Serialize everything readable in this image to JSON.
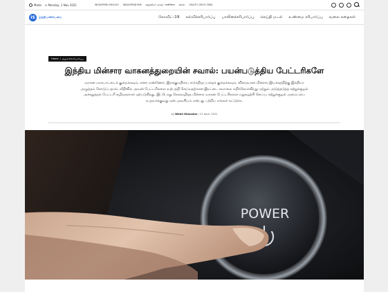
{
  "topbar": {
    "mode_label": "Mode",
    "date": "Monday, 1 Nov 2021",
    "links": [
      "INDIASPEND ENGLISH",
      "INDIASPEND हिन्दी",
      "ബ്രേക്കിംഗ് ഫാക്ട് • प्रामाणिकता",
      "తెలుగు",
      "HEALTH CHECK TAMIL"
    ]
  },
  "logo": {
    "mark": "IS",
    "text": "இந்தியாஸ்பெண்ட்"
  },
  "nav": {
    "items": [
      "கோவிட்-19",
      "கல்விச்சரிபார்ப்பு",
      "பாலினச்சரிபார்ப்பு",
      "செய்தி மடல்",
      "உண்மை சரிபார்ப்பு",
      "வலை கதைகள்"
    ]
  },
  "breadcrumb": {
    "home": "Home",
    "separator": "/",
    "section": "சூழலைச்சரிபார்ப்பு"
  },
  "article": {
    "title": "இந்திய மின்சார வாகனத்துறையின் சவால்: பயன்படுத்திய பேட்டரிகளே",
    "summary_lines": [
      "வாகன மாசுபாட்டைக் குறைக்கவும், கச்சா எண்ணெய் இறக்குமதியை சார்ந்திருப்பதைக் குறைக்கவும், விரைவான மின்சார இயக்கத்திற்கு இந்தியா",
      "அழுத்தம் கொடுப்பதால், வீதிவில் அவன் பேட்டரிகளை உற்பத்தி செய்வதற்கான இரட்டை சவாலை எதிர்கொள்கிறது மற்றும் அடுத்தடுத்த சுற்றுச்சூழல்",
      "அச்சுறுத்தல் பேட்டரி கழிவுகளால் ஏற்படுகிறது. இப்போது செலவழித்த மின்சார வாகன பேட்டரிகளை மறுசுழற்சி செய்ய, சுற்றுச்சூழல் அமைப்பை",
      "உருவாக்குவது ஏன் அவசியம் என்பது பற்றிய எங்கள் கட்டுரை."
    ],
    "byline_prefix": "by",
    "author": "Nikhil Ghanekar",
    "date": "21 April, 2021"
  },
  "hero": {
    "button_text": "POWER",
    "alt_subject": "finger-pressing-power-button"
  },
  "colors": {
    "brand": "#2a6bd8",
    "page_bg": "#efefef"
  }
}
